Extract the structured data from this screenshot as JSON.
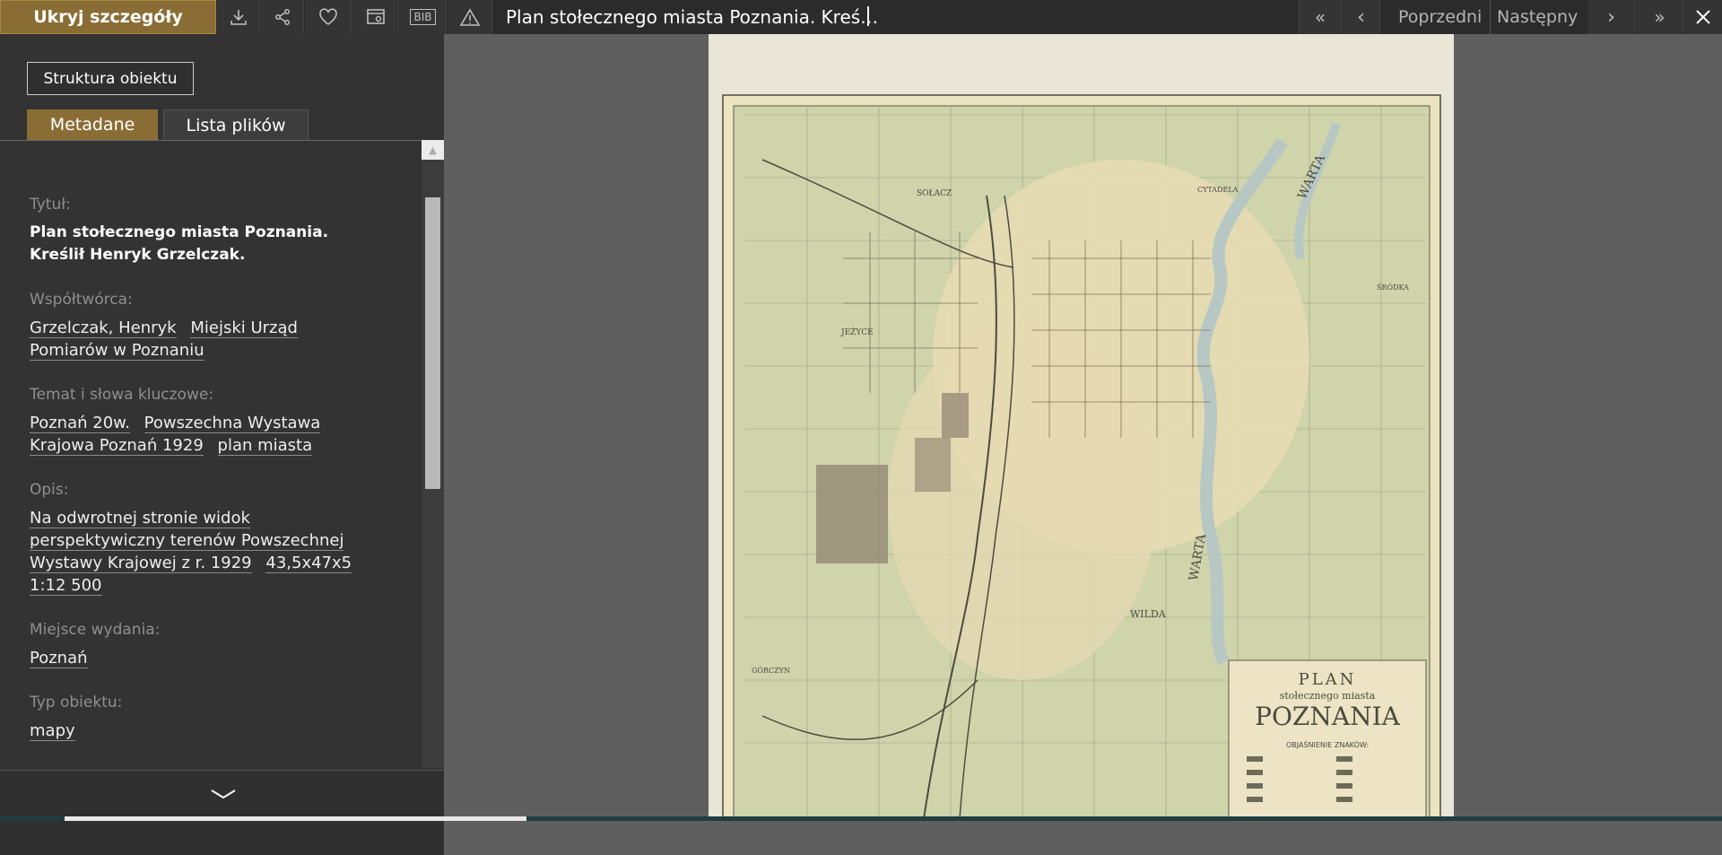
{
  "topbar": {
    "hide_details": "Ukryj szczegóły",
    "title": "Plan stołecznego miasta Poznania. Kreś…",
    "prev": "Poprzedni",
    "next": "Następny",
    "icons": [
      "download-icon",
      "share-icon",
      "heart-icon",
      "browser-icon",
      "bib-icon",
      "warning-icon",
      "first-icon",
      "prev-icon",
      "next-icon",
      "last-icon",
      "close-icon"
    ],
    "bib": "BIB"
  },
  "sidebar": {
    "structure_button": "Struktura obiektu",
    "tabs": [
      "Metadane",
      "Lista plików"
    ],
    "metadata": [
      {
        "label": "Tytuł:",
        "value": "Plan stołecznego miasta Poznania. Kreślił Henryk Grzelczak."
      },
      {
        "label": "Współtwórca:",
        "values": [
          "Grzelczak, Henryk",
          "Miejski Urząd Pomiarów w Poznaniu"
        ]
      },
      {
        "label": "Temat i słowa kluczowe:",
        "values": [
          "Poznań 20w.",
          "Powszechna Wystawa Krajowa Poznań 1929",
          "plan miasta"
        ]
      },
      {
        "label": "Opis:",
        "values": [
          "Na odwrotnej stronie widok perspektywiczny terenów Powszechnej Wystawy Krajowej z r. 1929",
          "43,5x47x5",
          "1:12 500"
        ]
      },
      {
        "label": "Miejsce wydania:",
        "values": [
          "Poznań"
        ]
      },
      {
        "label": "Typ obiektu:",
        "values": [
          "mapy"
        ]
      }
    ]
  },
  "map": {
    "heading_line1": "PLAN",
    "heading_line2": "stołecznego miasta",
    "heading_line3": "POZNANIA",
    "legend_title": "OBJAŚNIENIE ZNAKÓW:",
    "labels": [
      "WARTA",
      "WARTA",
      "SOŁACZ",
      "JEŻYCE",
      "WILDA",
      "GÓRCZYN",
      "CYTADELA",
      "ŚRÓDKA"
    ]
  }
}
